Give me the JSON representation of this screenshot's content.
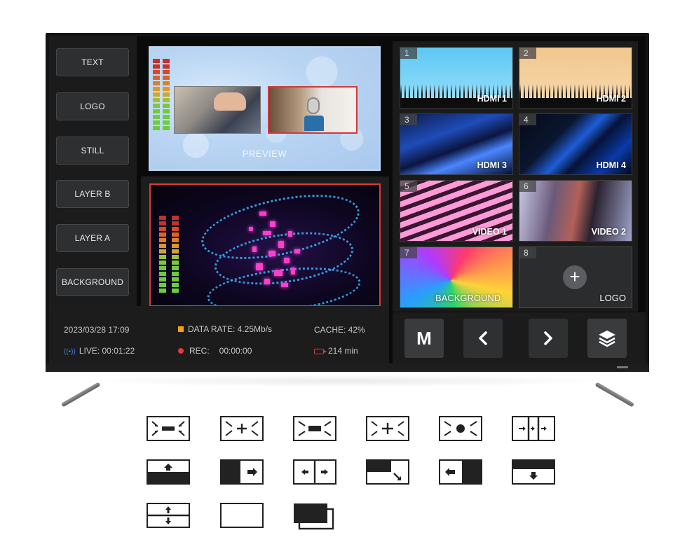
{
  "layer_buttons": [
    "TEXT",
    "LOGO",
    "STILL",
    "LAYER B",
    "LAYER A",
    "BACKGROUND"
  ],
  "preview": {
    "label": "PREVIEW"
  },
  "status": {
    "datetime": "2023/03/28  17:09",
    "data_rate": "DATA RATE: 4.25Mb/s",
    "cache": "CACHE: 42%",
    "live": "LIVE: 00:01:22",
    "rec_label": "REC:",
    "rec_time": "00:00:00",
    "remaining": "214 min"
  },
  "sources": [
    {
      "num": "1",
      "name": "HDMI 1"
    },
    {
      "num": "2",
      "name": "HDMI 2"
    },
    {
      "num": "3",
      "name": "HDMI 3"
    },
    {
      "num": "4",
      "name": "HDMI 4"
    },
    {
      "num": "5",
      "name": "VIDEO 1"
    },
    {
      "num": "6",
      "name": "VIDEO 2"
    },
    {
      "num": "7",
      "name": "BACKGROUND"
    },
    {
      "num": "8",
      "name": "LOGO"
    }
  ],
  "controls": {
    "m_label": "M",
    "prev_glyph": "‹",
    "next_glyph": "›"
  },
  "icons": {
    "layers": "layers-icon",
    "add": "plus-icon",
    "live": "broadcast-icon",
    "remaining": "camera-icon"
  },
  "colors": {
    "program_border": "#d73b3b",
    "rec": "#e23c3c",
    "data_rate": "#f2a113",
    "live": "#3f7fe0"
  }
}
